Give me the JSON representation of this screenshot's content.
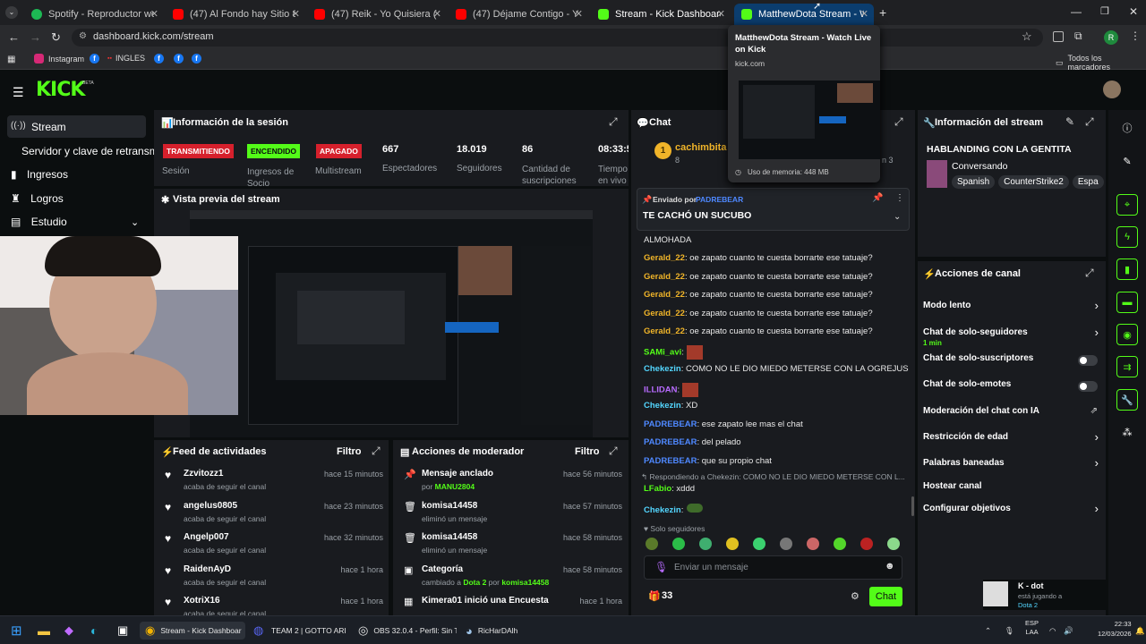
{
  "tabs": [
    {
      "title": "Spotify - Reproductor web: mús",
      "color": "#1db954"
    },
    {
      "title": "(47) Al Fondo hay Sitio 8: Franc",
      "color": "#ff0000"
    },
    {
      "title": "(47) Reik - Yo Quisiera (Video)",
      "color": "#ff0000"
    },
    {
      "title": "(47) Déjame Contigo - YouTube",
      "color": "#ff0000"
    },
    {
      "title": "Stream - Kick Dashboard",
      "color": "#53fc18"
    },
    {
      "title": "MatthewDota Stream - Watch L",
      "color": "#53fc18"
    }
  ],
  "tooltip": {
    "title": "MatthewDota Stream - Watch Live on Kick",
    "domain": "kick.com",
    "memory": "Uso de memoria: 448 MB"
  },
  "url": "dashboard.kick.com/stream",
  "bookmarks": {
    "instagram": "Instagram",
    "ingles": "INGLES",
    "all": "Todos los marcadores"
  },
  "logo": "KICK",
  "logo_beta": "BETA",
  "nav": {
    "stream": "Stream",
    "server": "Servidor y clave de retransm",
    "income": "Ingresos",
    "achievements": "Logros",
    "studio": "Estudio"
  },
  "session": {
    "title": "Información de la sesión",
    "status": [
      {
        "badge": "TRANSMITIENDO",
        "label": "Sesión"
      },
      {
        "badge": "ENCENDIDO",
        "label": "Ingresos de Socio"
      },
      {
        "badge": "APAGADO",
        "label": "Multistream"
      }
    ],
    "stats": [
      {
        "value": "667",
        "label": "Espectadores"
      },
      {
        "value": "18.019",
        "label": "Seguidores"
      },
      {
        "value": "86",
        "label": "Cantidad de suscripciones"
      },
      {
        "value": "08:33:5",
        "label": "Tiempo en vivo"
      }
    ]
  },
  "preview_title": "Vista previa del stream",
  "feed": {
    "title": "Feed de actividades",
    "filter": "Filtro",
    "items": [
      {
        "user": "Zzvitozz1",
        "action": "acaba de seguir el canal",
        "time": "hace 15 minutos"
      },
      {
        "user": "angelus0805",
        "action": "acaba de seguir el canal",
        "time": "hace 23 minutos"
      },
      {
        "user": "Angelp007",
        "action": "acaba de seguir el canal",
        "time": "hace 32 minutos"
      },
      {
        "user": "RaidenAyD",
        "action": "acaba de seguir el canal",
        "time": "hace 1 hora"
      },
      {
        "user": "XotriX16",
        "action": "acaba de seguir el canal",
        "time": "hace 1 hora"
      }
    ]
  },
  "mod": {
    "title": "Acciones de moderador",
    "filter": "Filtro",
    "items": [
      {
        "title": "Mensaje anclado",
        "sub_pre": "por ",
        "sub_user": "MANU2804",
        "time": "hace 56 minutos"
      },
      {
        "title": "komisa14458",
        "sub_pre": "eliminó un mensaje",
        "sub_user": "",
        "time": "hace 57 minutos"
      },
      {
        "title": "komisa14458",
        "sub_pre": "eliminó un mensaje",
        "sub_user": "",
        "time": "hace 58 minutos"
      },
      {
        "title": "Categoría",
        "sub_pre": "cambiado a ",
        "sub_user": "Dota 2",
        "sub_mid": " por ",
        "sub_user2": "komisa14458",
        "time": "hace 58 minutos"
      },
      {
        "title": "Kimera01 inició una Encuesta",
        "sub_pre": "",
        "sub_user": "",
        "time": "hace 1 hora"
      }
    ]
  },
  "chat": {
    "title": "Chat",
    "top_user": "cachimbita",
    "top_count": "8",
    "top_suffix": "n 3",
    "pinned_by_pre": "Enviado por ",
    "pinned_by": "PADREBEAR",
    "pinned_msg": "TE CACHÓ UN SUCUBO",
    "messages": [
      {
        "user": "",
        "text": "ALMOHADA",
        "cls": ""
      },
      {
        "user": "Gerald_22",
        "text": ": oe zapato cuanto te cuesta borrarte ese tatuaje?",
        "cls": "user-y"
      },
      {
        "user": "Gerald_22",
        "text": ": oe zapato cuanto te cuesta borrarte ese tatuaje?",
        "cls": "user-y"
      },
      {
        "user": "Gerald_22",
        "text": ": oe zapato cuanto te cuesta borrarte ese tatuaje?",
        "cls": "user-y"
      },
      {
        "user": "Gerald_22",
        "text": ": oe zapato cuanto te cuesta borrarte ese tatuaje?",
        "cls": "user-y"
      },
      {
        "user": "Gerald_22",
        "text": ": oe zapato cuanto te cuesta borrarte ese tatuaje?",
        "cls": "user-y"
      },
      {
        "user": "SAMi_avi",
        "text": ":",
        "cls": "user-g"
      },
      {
        "user": "Chekezin",
        "text": ": COMO NO LE DIO MIEDO METERSE CON LA OGREJUS",
        "cls": "user-c"
      },
      {
        "user": "ILLIDAN",
        "text": ":",
        "cls": "user-p"
      },
      {
        "user": "Chekezin",
        "text": ": XD",
        "cls": "user-c"
      },
      {
        "user": "PADREBEAR",
        "text": ": ese zapato lee mas el chat",
        "cls": "user-b"
      },
      {
        "user": "PADREBEAR",
        "text": ": del pelado",
        "cls": "user-b"
      },
      {
        "user": "PADREBEAR",
        "text": ": que su propio chat",
        "cls": "user-b"
      }
    ],
    "reply_note": "Respondiendo a Chekezin: COMO NO LE DIO MIEDO METERSE CON L...",
    "reply_user": "LFabio",
    "reply_text": ": xddd",
    "last_user": "Chekezin",
    "last_text": ":",
    "followers_only": "Solo seguidores",
    "placeholder": "Enviar un mensaje",
    "count": "33",
    "send": "Chat"
  },
  "stream_info": {
    "title": "Información del stream",
    "stream_title": "HABLANDING CON LA GENTITA",
    "category": "Conversando",
    "tags": [
      "Spanish",
      "CounterStrike2",
      "Espa"
    ]
  },
  "channel": {
    "title": "Acciones de canal",
    "items": [
      {
        "label": "Modo lento",
        "sub": "",
        "kind": "arrow"
      },
      {
        "label": "Chat de solo-seguidores",
        "sub": "1 min",
        "kind": "arrow"
      },
      {
        "label": "Chat de solo-suscriptores",
        "sub": "",
        "kind": "toggle"
      },
      {
        "label": "Chat de solo-emotes",
        "sub": "",
        "kind": "toggle"
      },
      {
        "label": "Moderación del chat con IA",
        "sub": "",
        "kind": "ext"
      },
      {
        "label": "Restricción de edad",
        "sub": "",
        "kind": "arrow"
      },
      {
        "label": "Palabras baneadas",
        "sub": "",
        "kind": "arrow"
      },
      {
        "label": "Hostear canal",
        "sub": "",
        "kind": "none"
      },
      {
        "label": "Configurar objetivos",
        "sub": "",
        "kind": "arrow"
      }
    ]
  },
  "notify": {
    "name": "K - dot",
    "line1": "está jugando a",
    "line2": "Dota 2"
  },
  "taskbar": {
    "chrome": "Stream - Kick Dashboar",
    "team": "TEAM 2 | GOTTO ARI",
    "obs": "OBS 32.0.4 - Perfil: Sin T",
    "steam": "RicHarDAlh",
    "lang1": "ESP",
    "lang2": "LAA",
    "time": "22:33",
    "date": "12/03/2026"
  }
}
